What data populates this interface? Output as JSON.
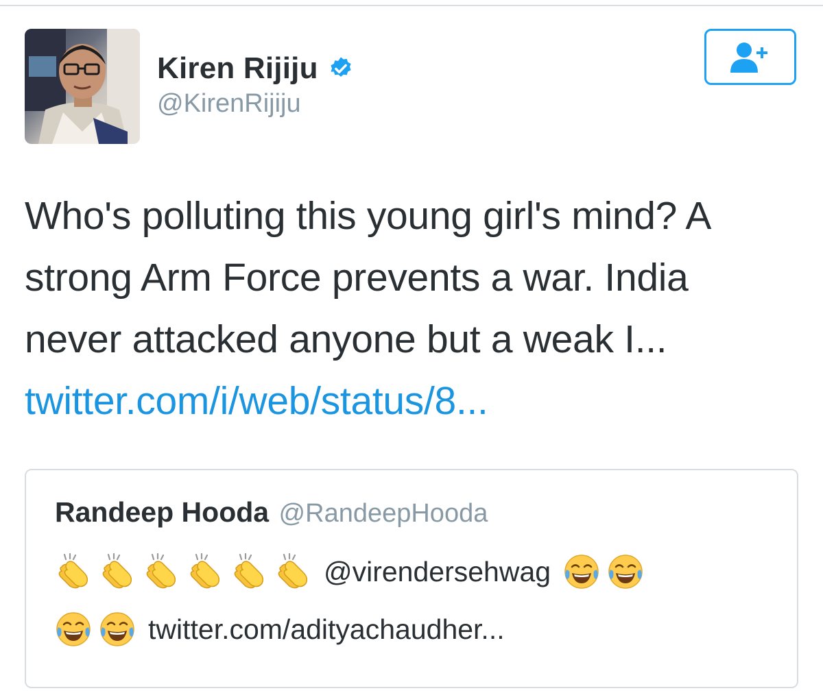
{
  "author": {
    "display_name": "Kiren Rijiju",
    "handle": "@KirenRijiju",
    "verified": true
  },
  "follow_button": {
    "icon": "add-user-icon",
    "color": "#1da1f2"
  },
  "tweet": {
    "lines": [
      "Who's polluting this young girl's mind? A",
      "strong Arm Force prevents a war. India",
      "never attacked anyone but a weak I..."
    ],
    "link": "twitter.com/i/web/status/8..."
  },
  "quoted_tweet": {
    "display_name": "Randeep Hooda",
    "handle": "@RandeepHooda",
    "mention": "@virendersehwag",
    "link": "twitter.com/adityachaudher...",
    "emoji": {
      "clap": "clapping-hands-emoji",
      "laugh": "tears-of-joy-emoji"
    }
  },
  "colors": {
    "text": "#292f33",
    "secondary": "#8899a6",
    "link": "#1b95e0",
    "border": "#d8dde1"
  }
}
